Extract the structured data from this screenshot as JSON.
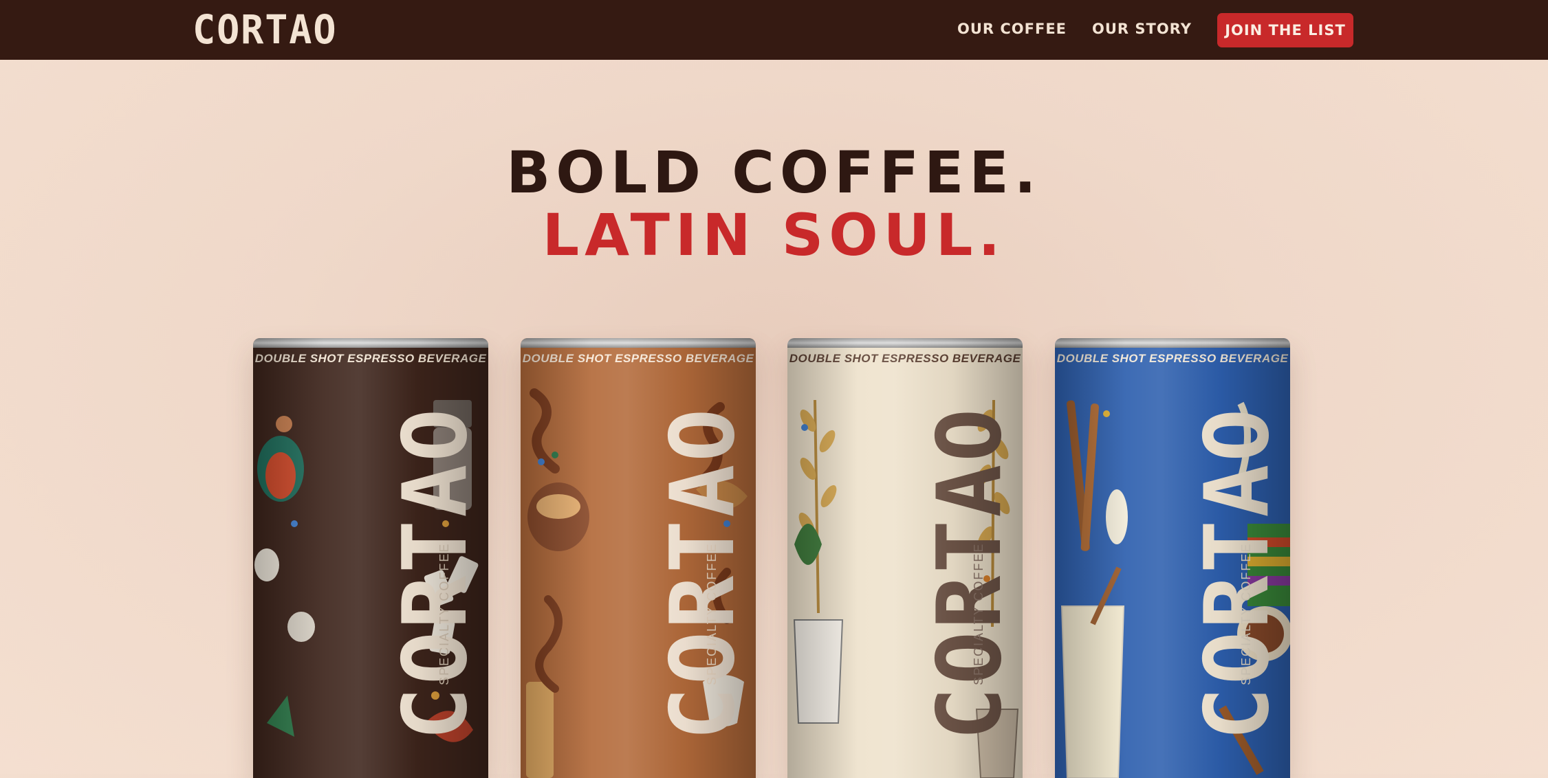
{
  "nav": {
    "logo": "CORTAO",
    "links": [
      "OUR COFFEE",
      "OUR STORY"
    ],
    "cta": "JOIN THE LIST"
  },
  "hero": {
    "line1": "BOLD COFFEE.",
    "line2": "LATIN SOUL."
  },
  "cans": [
    {
      "tagline": "DOUBLE SHOT ESPRESSO BEVERAGE",
      "brand": "CORTAO",
      "subtitle": "SPECIALTY COFFEE"
    },
    {
      "tagline": "DOUBLE SHOT ESPRESSO BEVERAGE",
      "brand": "CORTAO",
      "subtitle": "SPECIALTY COFFEE"
    },
    {
      "tagline": "DOUBLE SHOT ESPRESSO BEVERAGE",
      "brand": "CORTAO",
      "subtitle": "SPECIALTY COFFEE"
    },
    {
      "tagline": "DOUBLE SHOT ESPRESSO BEVERAGE",
      "brand": "CORTAO",
      "subtitle": "SPECIALTY COFFEE"
    }
  ],
  "colors": {
    "nav_bg": "#351a12",
    "accent_red": "#c8292a",
    "headline_dark": "#2e1812",
    "can_espresso": "#3d241b",
    "can_caramel": "#b36a3a",
    "can_cream": "#eee2cc",
    "can_blue": "#2d5fae"
  }
}
